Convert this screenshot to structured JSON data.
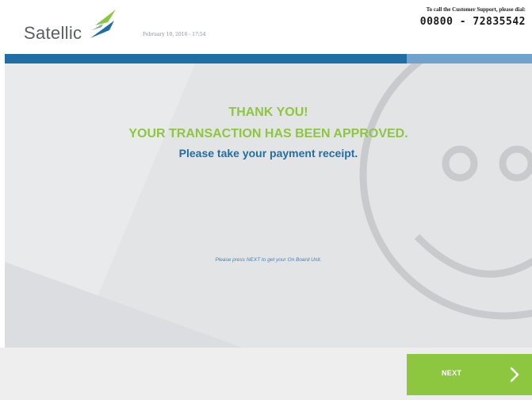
{
  "brand": {
    "name": "Satellic",
    "logo_icon": "satellic-logo-icon",
    "colors": {
      "green": "#8dc63f",
      "blue": "#1f6ea6",
      "light_blue": "#6fa3cc"
    }
  },
  "header": {
    "datetime": "February 10, 2016 - 17:54",
    "support_label": "To call the Customer Support, please dial:",
    "support_number": "00800 - 72835542"
  },
  "main": {
    "thank_you": "THANK YOU!",
    "approved": "YOUR TRANSACTION HAS BEEN APPROVED.",
    "receipt": "Please take your payment receipt.",
    "hint": "Please press NEXT to get your On Board Unit.",
    "background_icon": "smiley-face-icon"
  },
  "footer": {
    "next_label": "NEXT",
    "next_icon": "chevron-right-icon"
  }
}
